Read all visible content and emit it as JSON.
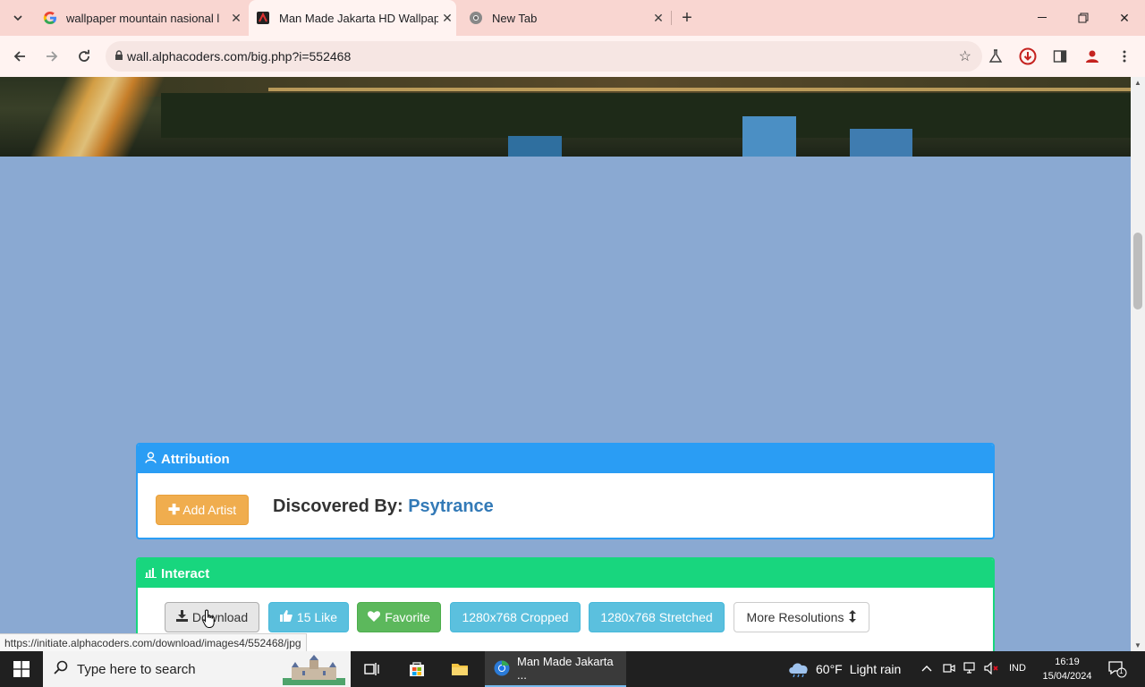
{
  "browser": {
    "tabs": [
      {
        "title": "wallpaper mountain nasional l",
        "favicon": "google-icon"
      },
      {
        "title": "Man Made Jakarta HD Wallpap",
        "favicon": "alphacoders-icon",
        "active": true
      },
      {
        "title": "New Tab",
        "favicon": "chrome-icon"
      }
    ],
    "url": "wall.alphacoders.com/big.php?i=552468"
  },
  "page": {
    "attribution": {
      "title": "Attribution",
      "add_artist_label": "Add Artist",
      "discovered_label": "Discovered By:",
      "discovered_user": "Psytrance"
    },
    "interact": {
      "title": "Interact",
      "download_label": "Download",
      "like_label": "15 Like",
      "favorite_label": "Favorite",
      "cropped_label": "1280x768 Cropped",
      "stretched_label": "1280x768 Stretched",
      "more_label": "More Resolutions"
    },
    "status_url": "https://initiate.alphacoders.com/download/images4/552468/jpg"
  },
  "taskbar": {
    "search_placeholder": "Type here to search",
    "active_window": "Man Made Jakarta ...",
    "weather_temp": "60°F",
    "weather_desc": "Light rain",
    "language": "IND",
    "time": "16:19",
    "date": "15/04/2024",
    "notification_count": "1"
  },
  "colors": {
    "page_background": "#8aa9d2",
    "attribution_header": "#2a9df4",
    "interact_header": "#18d67e",
    "add_artist": "#f0ad4e",
    "like": "#5bc0de",
    "favorite": "#5cb85c",
    "link": "#337ab7"
  }
}
